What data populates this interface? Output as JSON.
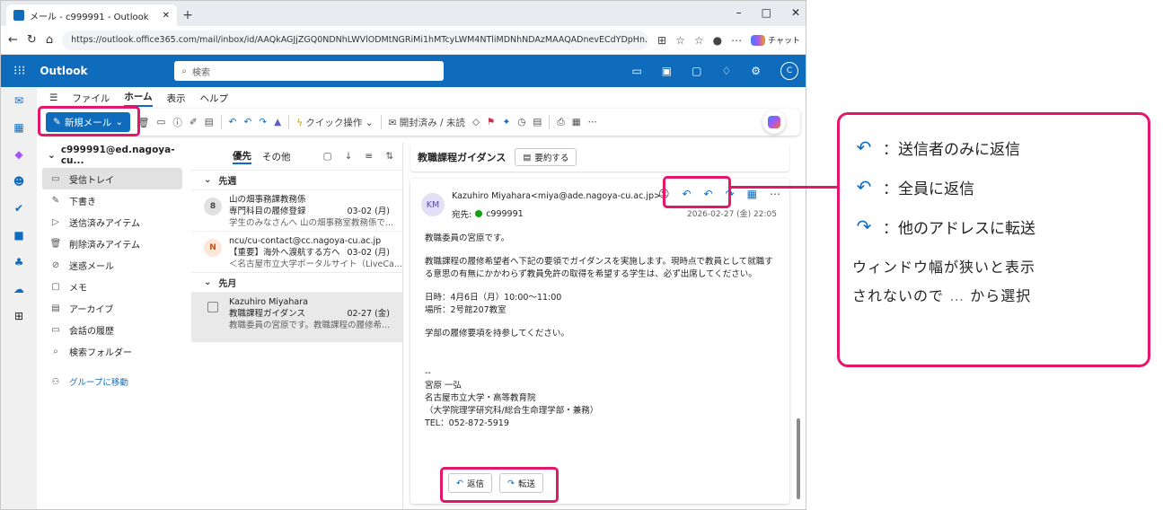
{
  "browser": {
    "tab_title": "メール - c999991 - Outlook",
    "url": "https://outlook.office365.com/mail/inbox/id/AAQkAGJjZGQ0NDNhLWVlODMtNGRiMi1hMTcyLWM4NTliMDNhNDAzMAAQADnevECdYDpHn...",
    "copilot_label": "チャット"
  },
  "outlook": {
    "brand": "Outlook",
    "search_placeholder": "検索",
    "avatar_initial": "C"
  },
  "ribbon": {
    "tabs": [
      "ファイル",
      "ホーム",
      "表示",
      "ヘルプ"
    ],
    "new_mail": "新規メール",
    "quick_steps": "クイック操作",
    "read_unread": "開封済み / 未読"
  },
  "folders": {
    "account": "c999991@ed.nagoya-cu...",
    "items": [
      {
        "label": "受信トレイ",
        "selected": true
      },
      {
        "label": "下書き"
      },
      {
        "label": "送信済みアイテム"
      },
      {
        "label": "削除済みアイテム"
      },
      {
        "label": "迷惑メール"
      },
      {
        "label": "メモ"
      },
      {
        "label": "アーカイブ"
      },
      {
        "label": "会話の履歴"
      },
      {
        "label": "検索フォルダー"
      }
    ],
    "groups_link": "グループに移動"
  },
  "message_list": {
    "tab_focused": "優先",
    "tab_other": "その他",
    "section_last_week": "先週",
    "section_last_month": "先月",
    "messages": [
      {
        "sender": "山の畑事務課教務係",
        "subject": "専門科目の履修登録",
        "date": "03-02 (月)",
        "preview": "学生のみなさんへ 山の畑事務室教務係で...",
        "avatar": "8"
      },
      {
        "sender": "ncu/cu-contact@cc.nagoya-cu.ac.jp",
        "subject": "【重要】海外へ渡航する方へ",
        "date": "03-02 (月)",
        "preview": "＜名古屋市立大学ポータルサイト（LiveCa...",
        "avatar": "N"
      },
      {
        "sender": "Kazuhiro Miyahara",
        "subject": "教職課程ガイダンス",
        "date": "02-27 (金)",
        "preview": "教職委員の宮原です。教職課程の履修希..."
      }
    ]
  },
  "reading": {
    "subject": "教職課程ガイダンス",
    "summarize": "要約する",
    "avatar": "KM",
    "from": "Kazuhiro Miyahara<miya@ade.nagoya-cu.ac.jp>",
    "to_label": "宛先:",
    "to_value": "c999991",
    "date": "2026-02-27 (金) 22:05",
    "body": [
      "教職委員の宮原です。",
      "教職課程の履修希望者へ下記の要領でガイダンスを実施します。現時点で教員として就職する意思の有無にかかわらず教員免許の取得を希望する学生は、必ず出席してください。",
      "日時：4月6日（月）10:00～11:00",
      "場所：2号館207教室",
      "学部の履修要項を持参してください。",
      "--",
      "宮原 一弘",
      "名古屋市立大学・高等教育院",
      "（大学院理学研究科/総合生命理学部・兼務）",
      "TEL：052-872-5919"
    ],
    "reply_button": "返信",
    "forward_button": "転送"
  },
  "callout": {
    "reply_desc": "：送信者のみに返信",
    "reply_all_desc": "：全員に返信",
    "forward_desc": "：他のアドレスに転送",
    "note_line1": "ウィンドウ幅が狭いと表示",
    "note_line2": "されないので",
    "note_dots": "…",
    "note_line3": "から選択"
  },
  "colors": {
    "accent": "#0f6cbd",
    "highlight": "#e5176c"
  }
}
